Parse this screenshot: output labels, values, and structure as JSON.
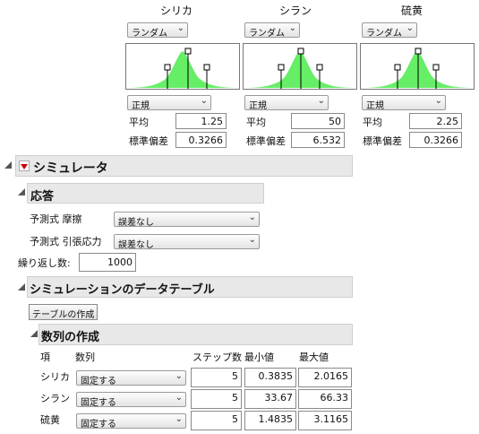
{
  "factors": [
    {
      "name": "シリカ",
      "dist_type": "ランダム",
      "dist": "正規",
      "mean_label": "平均",
      "sd_label": "標準偏差",
      "mean": "1.25",
      "sd": "0.3266"
    },
    {
      "name": "シラン",
      "dist_type": "ランダム",
      "dist": "正規",
      "mean_label": "平均",
      "sd_label": "標準偏差",
      "mean": "50",
      "sd": "6.532"
    },
    {
      "name": "硫黄",
      "dist_type": "ランダム",
      "dist": "正規",
      "mean_label": "平均",
      "sd_label": "標準偏差",
      "mean": "2.25",
      "sd": "0.3266"
    }
  ],
  "simulator": {
    "title": "シミュレータ",
    "response_title": "応答",
    "responses": [
      {
        "label": "予測式 摩擦",
        "value": "誤差なし"
      },
      {
        "label": "予測式 引張応力",
        "value": "誤差なし"
      }
    ],
    "reps_label": "繰り返し数:",
    "reps_value": "1000"
  },
  "datatable": {
    "title": "シミュレーションのデータテーブル",
    "make_button": "テーブルの作成"
  },
  "sequence": {
    "title": "数列の作成",
    "headers": {
      "item": "項",
      "sequence": "数列",
      "steps": "ステップ数",
      "min": "最小値",
      "max": "最大値"
    },
    "rows": [
      {
        "item": "シリカ",
        "mode": "固定する",
        "steps": "5",
        "min": "0.3835",
        "max": "2.0165"
      },
      {
        "item": "シラン",
        "mode": "固定する",
        "steps": "5",
        "min": "33.67",
        "max": "66.33"
      },
      {
        "item": "硫黄",
        "mode": "固定する",
        "steps": "5",
        "min": "1.4835",
        "max": "3.1165"
      }
    ]
  },
  "colors": {
    "curve_fill": "#66ee66",
    "red_triangle": "#cc0000",
    "section_bg": "#e8e8e8"
  },
  "icons": [
    "chevron-down-icon",
    "disclosure-triangle-icon",
    "red-triangle-menu-icon"
  ]
}
